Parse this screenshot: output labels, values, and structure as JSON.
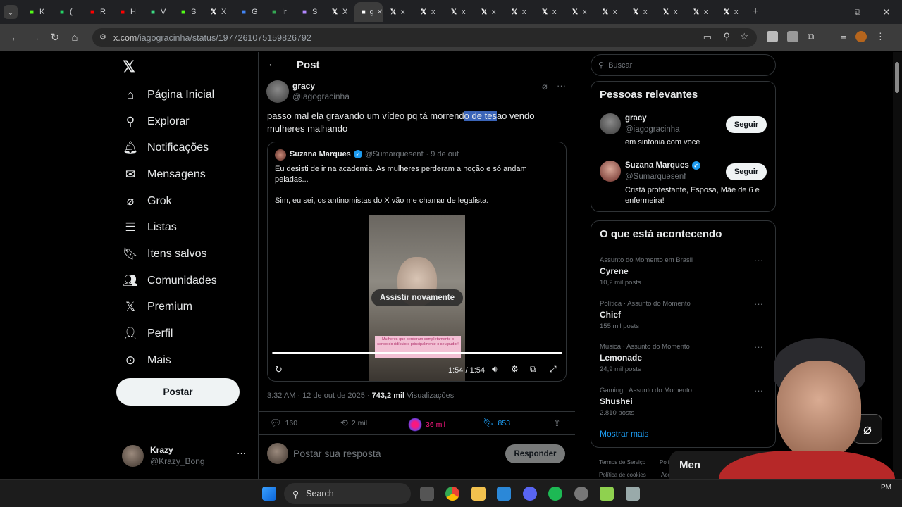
{
  "browser": {
    "tabs": [
      {
        "icon": "k-icon",
        "label": "K",
        "color": "#53fc18"
      },
      {
        "icon": "whatsapp-icon",
        "label": "(",
        "color": "#25d366"
      },
      {
        "icon": "youtube-icon",
        "label": "R",
        "color": "#ff0000"
      },
      {
        "icon": "youtube-icon",
        "label": "H",
        "color": "#ff0000"
      },
      {
        "icon": "v-icon",
        "label": "V",
        "color": "#3ddc84"
      },
      {
        "icon": "k-icon",
        "label": "S",
        "color": "#53fc18"
      },
      {
        "icon": "x-icon",
        "label": "X",
        "color": "#ffffff"
      },
      {
        "icon": "google-icon",
        "label": "G",
        "color": "#4285f4"
      },
      {
        "icon": "translate-icon",
        "label": "Ir",
        "color": "#34a853"
      },
      {
        "icon": "feather-icon",
        "label": "S",
        "color": "#b388ff"
      },
      {
        "icon": "x-icon",
        "label": "X",
        "color": "#ffffff"
      },
      {
        "icon": "g-icon",
        "label": "g",
        "color": "#ffffff",
        "active": true
      },
      {
        "icon": "x-icon",
        "label": "x",
        "color": "#ffffff"
      },
      {
        "icon": "x-icon",
        "label": "x",
        "color": "#ffffff"
      },
      {
        "icon": "x-icon",
        "label": "x",
        "color": "#ffffff"
      },
      {
        "icon": "x-icon",
        "label": "x",
        "color": "#ffffff"
      },
      {
        "icon": "x-icon",
        "label": "x",
        "color": "#ffffff"
      },
      {
        "icon": "x-icon",
        "label": "x",
        "color": "#ffffff"
      },
      {
        "icon": "x-icon",
        "label": "x",
        "color": "#ffffff"
      },
      {
        "icon": "x-icon",
        "label": "x",
        "color": "#ffffff"
      },
      {
        "icon": "x-icon",
        "label": "x",
        "color": "#ffffff"
      },
      {
        "icon": "x-icon",
        "label": "x",
        "color": "#ffffff"
      },
      {
        "icon": "x-icon",
        "label": "x",
        "color": "#ffffff"
      },
      {
        "icon": "x-icon",
        "label": "x",
        "color": "#ffffff"
      }
    ],
    "url_host": "x.com",
    "url_path": "/iagogracinha/status/1977261075159826792"
  },
  "nav": {
    "items": [
      {
        "label": "Página Inicial",
        "icon": "home-icon",
        "glyph": "⌂"
      },
      {
        "label": "Explorar",
        "icon": "search-icon",
        "glyph": "⚲"
      },
      {
        "label": "Notificações",
        "icon": "bell-icon",
        "glyph": "🔔︎"
      },
      {
        "label": "Mensagens",
        "icon": "mail-icon",
        "glyph": "✉"
      },
      {
        "label": "Grok",
        "icon": "grok-icon",
        "glyph": "⌀"
      },
      {
        "label": "Listas",
        "icon": "list-icon",
        "glyph": "☰"
      },
      {
        "label": "Itens salvos",
        "icon": "bookmark-icon",
        "glyph": "🔖︎"
      },
      {
        "label": "Comunidades",
        "icon": "communities-icon",
        "glyph": "👥︎"
      },
      {
        "label": "Premium",
        "icon": "x-premium-icon",
        "glyph": "𝕏"
      },
      {
        "label": "Perfil",
        "icon": "profile-icon",
        "glyph": "👤︎"
      },
      {
        "label": "Mais",
        "icon": "more-circle-icon",
        "glyph": "⊙"
      }
    ],
    "post_button": "Postar",
    "me": {
      "name": "Krazy",
      "handle": "@Krazy_Bong"
    }
  },
  "post": {
    "header": "Post",
    "author": "gracy",
    "handle": "@iagogracinha",
    "text_before": "passo mal ela gravando um vídeo pq tá morrend",
    "text_highlight": "o de tes",
    "text_after": "ao vendo mulheres malhando",
    "quote": {
      "author": "Suzana Marques",
      "handle": "@Sumarquesenf",
      "date": "· 9 de out",
      "line1": "Eu desisti de ir na academia. As mulheres perderam a noção e só andam peladas...",
      "line2": "Sim, eu sei, os antinomistas do X vão me chamar de legalista.",
      "video_overlay": "Assistir novamente",
      "video_caption": "Mulheres que perderam completamente o senso do ridículo e principalmente o seu pudor!",
      "video_time": "1:54 / 1:54"
    },
    "timestamp": "3:32 AM · 12 de out de 2025 ·",
    "views_count": "743,2 mil",
    "views_label": "Visualizações",
    "replies": "160",
    "reposts": "2 mil",
    "likes": "36 mil",
    "bookmarks": "853",
    "reply_placeholder": "Postar sua resposta",
    "reply_button": "Responder"
  },
  "sidebar": {
    "search_placeholder": "Buscar",
    "relevant_title": "Pessoas relevantes",
    "people": [
      {
        "name": "gracy",
        "handle": "@iagogracinha",
        "bio": "em sintonia com voce",
        "follow": "Seguir"
      },
      {
        "name": "Suzana Marques",
        "handle": "@Sumarquesenf",
        "bio": "Cristã protestante, Esposa, Mãe de 6 e enfermeira!",
        "follow": "Seguir"
      }
    ],
    "trending_title": "O que está acontecendo",
    "trends": [
      {
        "context": "Assunto do Momento em Brasil",
        "name": "Cyrene",
        "posts": "10,2 mil posts"
      },
      {
        "context": "Política · Assunto do Momento",
        "name": "Chief",
        "posts": "155 mil posts"
      },
      {
        "context": "Música · Assunto do Momento",
        "name": "Lemonade",
        "posts": "24,9 mil posts"
      },
      {
        "context": "Gaming · Assunto do Momento",
        "name": "Shushei",
        "posts": "2.810 posts"
      }
    ],
    "show_more": "Mostrar mais",
    "footer_1": "Termos de Serviço",
    "footer_2": "Polí",
    "footer_3": "Política de cookies",
    "footer_4": "Ace",
    "messages_partial": "Men"
  },
  "taskbar": {
    "search": "Search",
    "clock": "PM"
  },
  "colors": {
    "accent": "#1d9bf0",
    "like": "#f91880",
    "highlight": "#3a64b8"
  }
}
